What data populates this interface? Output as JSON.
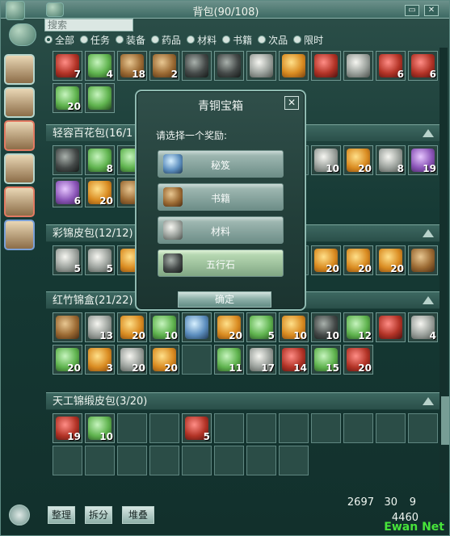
{
  "window": {
    "title": "背包(90/108)",
    "search_placeholder": "搜索"
  },
  "filters": [
    {
      "label": "全部",
      "selected": true
    },
    {
      "label": "任务",
      "selected": false
    },
    {
      "label": "装备",
      "selected": false
    },
    {
      "label": "药品",
      "selected": false
    },
    {
      "label": "材料",
      "selected": false
    },
    {
      "label": "书籍",
      "selected": false
    },
    {
      "label": "次品",
      "selected": false
    },
    {
      "label": "限时",
      "selected": false
    }
  ],
  "sections": {
    "top": {
      "items": [
        {
          "count": "7",
          "tone": "red"
        },
        {
          "count": "4",
          "tone": "green"
        },
        {
          "count": "18",
          "tone": "brown"
        },
        {
          "count": "2",
          "tone": "brown"
        },
        {
          "count": "",
          "tone": "dark"
        },
        {
          "count": "",
          "tone": "dark"
        },
        {
          "count": "",
          "tone": "gray"
        },
        {
          "count": "",
          "tone": "gold"
        },
        {
          "count": "",
          "tone": "red"
        },
        {
          "count": "",
          "tone": "gray"
        },
        {
          "count": "6",
          "tone": "red"
        },
        {
          "count": "6",
          "tone": "red"
        },
        {
          "count": "20",
          "tone": "green"
        },
        {
          "count": "",
          "tone": "green"
        }
      ]
    },
    "bag1": {
      "title": "轻容百花包(16/1",
      "items": [
        {
          "count": "",
          "tone": "dark"
        },
        {
          "count": "8",
          "tone": "green"
        },
        {
          "count": "",
          "tone": "green"
        },
        {
          "count": "",
          "tone": "empty"
        },
        {
          "count": "",
          "tone": "empty"
        },
        {
          "count": "",
          "tone": "empty"
        },
        {
          "count": "",
          "tone": "empty"
        },
        {
          "count": "",
          "tone": "empty"
        },
        {
          "count": "10",
          "tone": "gray"
        },
        {
          "count": "20",
          "tone": "gold"
        },
        {
          "count": "8",
          "tone": "gray"
        },
        {
          "count": "19",
          "tone": "purple"
        },
        {
          "count": "6",
          "tone": "purple"
        },
        {
          "count": "20",
          "tone": "gold"
        },
        {
          "count": "5",
          "tone": "brown"
        }
      ]
    },
    "bag2": {
      "title": "彩锦皮包(12/12)",
      "items": [
        {
          "count": "5",
          "tone": "gray"
        },
        {
          "count": "5",
          "tone": "gray"
        },
        {
          "count": "",
          "tone": "gold"
        },
        {
          "count": "",
          "tone": "empty"
        },
        {
          "count": "",
          "tone": "empty"
        },
        {
          "count": "",
          "tone": "empty"
        },
        {
          "count": "",
          "tone": "empty"
        },
        {
          "count": "",
          "tone": "empty"
        },
        {
          "count": "20",
          "tone": "gold"
        },
        {
          "count": "20",
          "tone": "gold"
        },
        {
          "count": "20",
          "tone": "gold"
        },
        {
          "count": "",
          "tone": "brown"
        }
      ]
    },
    "bag3": {
      "title": "红竹锦盒(21/22)",
      "items": [
        {
          "count": "",
          "tone": "brown"
        },
        {
          "count": "13",
          "tone": "gray"
        },
        {
          "count": "20",
          "tone": "gold"
        },
        {
          "count": "10",
          "tone": "green"
        },
        {
          "count": "",
          "tone": "blue"
        },
        {
          "count": "20",
          "tone": "gold"
        },
        {
          "count": "5",
          "tone": "green"
        },
        {
          "count": "10",
          "tone": "gold"
        },
        {
          "count": "10",
          "tone": "dark"
        },
        {
          "count": "12",
          "tone": "green"
        },
        {
          "count": "",
          "tone": "red"
        },
        {
          "count": "4",
          "tone": "gray"
        },
        {
          "count": "20",
          "tone": "green"
        },
        {
          "count": "3",
          "tone": "gold"
        },
        {
          "count": "20",
          "tone": "gray"
        },
        {
          "count": "20",
          "tone": "gold"
        },
        {
          "count": "",
          "tone": "empty"
        },
        {
          "count": "11",
          "tone": "green"
        },
        {
          "count": "17",
          "tone": "gray"
        },
        {
          "count": "14",
          "tone": "red"
        },
        {
          "count": "15",
          "tone": "green"
        },
        {
          "count": "20",
          "tone": "red"
        }
      ]
    },
    "bag4": {
      "title": "天工锦缎皮包(3/20)",
      "items": [
        {
          "count": "19",
          "tone": "red"
        },
        {
          "count": "10",
          "tone": "green"
        },
        {
          "count": "",
          "tone": "empty"
        },
        {
          "count": "",
          "tone": "empty"
        },
        {
          "count": "5",
          "tone": "red"
        },
        {
          "count": "",
          "tone": "empty"
        },
        {
          "count": "",
          "tone": "empty"
        },
        {
          "count": "",
          "tone": "empty"
        },
        {
          "count": "",
          "tone": "empty"
        },
        {
          "count": "",
          "tone": "empty"
        },
        {
          "count": "",
          "tone": "empty"
        },
        {
          "count": "",
          "tone": "empty"
        },
        {
          "count": "",
          "tone": "empty"
        },
        {
          "count": "",
          "tone": "empty"
        },
        {
          "count": "",
          "tone": "empty"
        },
        {
          "count": "",
          "tone": "empty"
        },
        {
          "count": "",
          "tone": "empty"
        },
        {
          "count": "",
          "tone": "empty"
        },
        {
          "count": "",
          "tone": "empty"
        },
        {
          "count": "",
          "tone": "empty"
        }
      ]
    }
  },
  "dialog": {
    "title": "青铜宝箱",
    "prompt": "请选择一个奖励:",
    "choices": [
      {
        "label": "秘笈",
        "tone": "blue",
        "selected": false
      },
      {
        "label": "书籍",
        "tone": "brown",
        "selected": false
      },
      {
        "label": "材料",
        "tone": "gray",
        "selected": false
      },
      {
        "label": "五行石",
        "tone": "dark",
        "selected": true
      }
    ],
    "confirm": "确定"
  },
  "bottom": {
    "buttons": [
      "整理",
      "拆分",
      "堆叠"
    ],
    "money_line1": "2697",
    "money_line1_b": "30",
    "money_line1_c": "9",
    "money_line2": "4460"
  },
  "watermark": "Ewan Net"
}
